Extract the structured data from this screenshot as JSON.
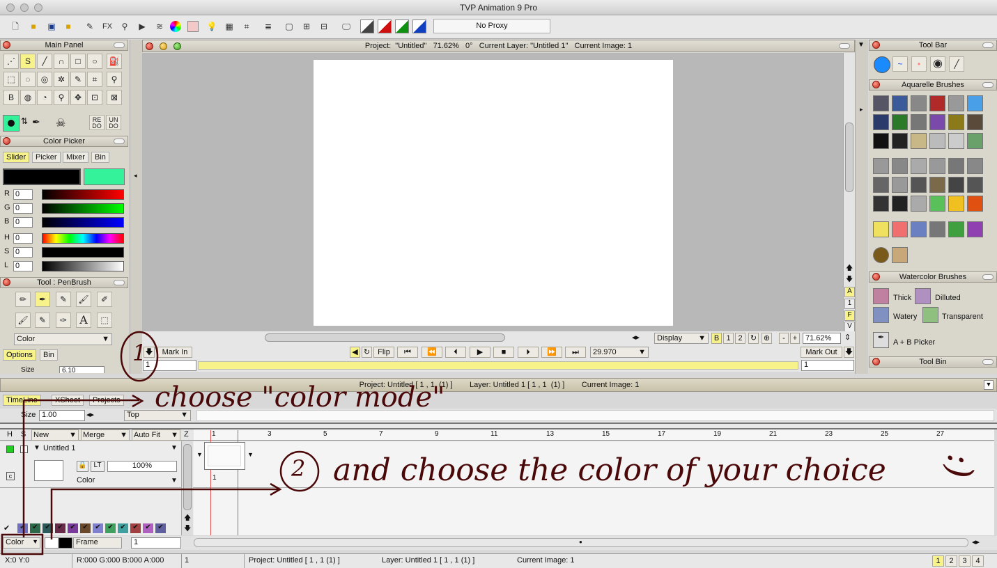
{
  "app_title": "TVP Animation 9 Pro",
  "toolbar": {
    "proxy": "No Proxy",
    "fx": "FX"
  },
  "main_panel": {
    "title": "Main Panel",
    "redo": "RE\nDO",
    "undo": "UN\nDO"
  },
  "color_picker": {
    "title": "Color Picker",
    "tabs": [
      "Slider",
      "Picker",
      "Mixer",
      "Bin"
    ],
    "channels": [
      {
        "label": "R",
        "value": "0"
      },
      {
        "label": "G",
        "value": "0"
      },
      {
        "label": "B",
        "value": "0"
      },
      {
        "label": "H",
        "value": "0"
      },
      {
        "label": "S",
        "value": "0"
      },
      {
        "label": "L",
        "value": "0"
      }
    ]
  },
  "tool_panel": {
    "title": "Tool : PenBrush",
    "mode": "Color",
    "tabs": [
      "Options",
      "Bin"
    ],
    "size_label": "Size",
    "size_value": "6.10"
  },
  "viewport": {
    "header": "Project:  \"Untitled\"   71.62%   0°   Current Layer: \"Untitled 1\"   Current Image: 1",
    "display": "Display",
    "b_label": "B",
    "zoom": "71.62%",
    "side_letters": [
      "A",
      "1",
      "F",
      "V"
    ],
    "mark_in": "Mark In",
    "mark_out": "Mark Out",
    "flip": "Flip",
    "fps": "29.970",
    "frame_in": "1",
    "frame_out": "1"
  },
  "right_panels": {
    "tool_bar": "Tool Bar",
    "aquarelle": "Aquarelle Brushes",
    "watercolor": "Watercolor Brushes",
    "watercolor_items": [
      "Thick",
      "Dilluted",
      "Watery",
      "Transparent"
    ],
    "ab_picker": "A + B Picker",
    "tool_bin": "Tool Bin"
  },
  "timeline": {
    "header": "Project: Untitled [ 1 , 1  (1) ]        Layer: Untitled 1 [ 1 , 1  (1) ]        Current Image: 1",
    "tabs": [
      "TimeLine",
      "XSheet",
      "Projects"
    ],
    "size_label": "Size",
    "size_value": "1.00",
    "top_label": "Top",
    "cols": [
      "H",
      "S",
      "New",
      "Merge",
      "Auto Fit",
      "Z"
    ],
    "layer_name": "Untitled 1",
    "opacity": "100%",
    "lt": "LT",
    "c": "c",
    "layer_mode": "Color",
    "ruler": [
      "1",
      "3",
      "5",
      "7",
      "9",
      "11",
      "13",
      "15",
      "17",
      "19",
      "21",
      "23",
      "25",
      "27"
    ],
    "frame_num": "1",
    "bottom_mode": "Color",
    "bottom_frame": "Frame",
    "bottom_value": "1"
  },
  "status": {
    "xy": "X:0  Y:0",
    "rgba": "R:000 G:000 B:000 A:000",
    "one": "1",
    "project": "Project: Untitled [ 1 , 1  (1) ]",
    "layer": "Layer: Untitled 1 [ 1 , 1  (1) ]",
    "image": "Current Image: 1",
    "pages": [
      "1",
      "2",
      "3",
      "4"
    ]
  },
  "annotations": {
    "step1_num": "1",
    "step1": "choose \"color mode\"",
    "step2_num": "2",
    "step2": "and choose the color of your choice",
    "smiley": ":)"
  },
  "colors": {
    "accent_green": "#33f29a",
    "highlight_yellow": "#f7f38a",
    "annotation": "#4a0808"
  }
}
